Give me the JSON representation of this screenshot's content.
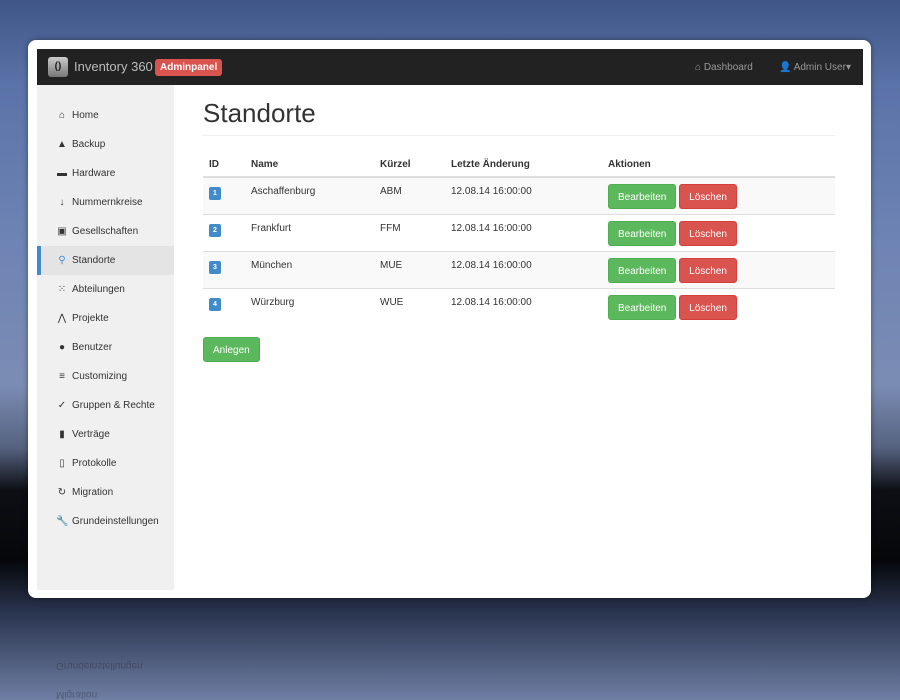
{
  "navbar": {
    "logo_icon": "inventory-logo-icon",
    "brand": "Inventory 360",
    "badge": "Adminpanel",
    "dashboard": "Dashboard",
    "user": "Admin User"
  },
  "sidebar": {
    "items": [
      {
        "label": "Home",
        "icon": "home-icon"
      },
      {
        "label": "Backup",
        "icon": "lock-icon"
      },
      {
        "label": "Hardware",
        "icon": "hdd-icon"
      },
      {
        "label": "Nummernkreise",
        "icon": "sort-numeric-icon"
      },
      {
        "label": "Gesellschaften",
        "icon": "briefcase-icon"
      },
      {
        "label": "Standorte",
        "icon": "map-marker-icon",
        "active": true
      },
      {
        "label": "Abteilungen",
        "icon": "grid-icon"
      },
      {
        "label": "Projekte",
        "icon": "road-icon"
      },
      {
        "label": "Benutzer",
        "icon": "user-icon"
      },
      {
        "label": "Customizing",
        "icon": "list-icon"
      },
      {
        "label": "Gruppen & Rechte",
        "icon": "check-circle-icon"
      },
      {
        "label": "Verträge",
        "icon": "book-icon"
      },
      {
        "label": "Protokolle",
        "icon": "file-icon"
      },
      {
        "label": "Migration",
        "icon": "refresh-icon"
      },
      {
        "label": "Grundeinstellungen",
        "icon": "wrench-icon"
      }
    ]
  },
  "page": {
    "title": "Standorte",
    "add_button": "Anlegen"
  },
  "table": {
    "headers": [
      "ID",
      "Name",
      "Kürzel",
      "Letzte Änderung",
      "Aktionen"
    ],
    "rows": [
      {
        "id": "1",
        "name": "Aschaffenburg",
        "short": "ABM",
        "changed": "12.08.14 16:00:00"
      },
      {
        "id": "2",
        "name": "Frankfurt",
        "short": "FFM",
        "changed": "12.08.14 16:00:00"
      },
      {
        "id": "3",
        "name": "München",
        "short": "MUE",
        "changed": "12.08.14 16:00:00"
      },
      {
        "id": "4",
        "name": "Würzburg",
        "short": "WUE",
        "changed": "12.08.14 16:00:00"
      }
    ],
    "edit_label": "Bearbeiten",
    "delete_label": "Löschen"
  },
  "colors": {
    "primary": "#428bca",
    "success": "#5cb85c",
    "danger": "#d9534f",
    "navbar": "#222222"
  }
}
